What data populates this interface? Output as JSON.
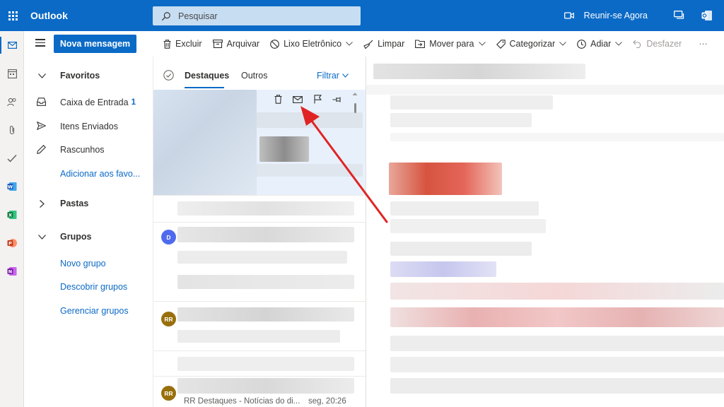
{
  "app": {
    "title": "Outlook"
  },
  "search": {
    "placeholder": "Pesquisar"
  },
  "header": {
    "meet_now": "Reunir-se Agora"
  },
  "new_message": {
    "label": "Nova mensagem"
  },
  "toolbar": {
    "delete": "Excluir",
    "archive": "Arquivar",
    "junk": "Lixo Eletrônico",
    "sweep": "Limpar",
    "move_to": "Mover para",
    "categorize": "Categorizar",
    "snooze": "Adiar",
    "undo": "Desfazer",
    "more": "···"
  },
  "folders": {
    "favorites": "Favoritos",
    "inbox": "Caixa de Entrada",
    "inbox_count": "1",
    "sent": "Itens Enviados",
    "drafts": "Rascunhos",
    "add_favorite": "Adicionar aos favo...",
    "folders_header": "Pastas",
    "groups_header": "Grupos",
    "new_group": "Novo grupo",
    "discover_groups": "Descobrir grupos",
    "manage_groups": "Gerenciar grupos"
  },
  "message_list": {
    "tab_focused": "Destaques",
    "tab_other": "Outros",
    "filter": "Filtrar",
    "avatars": [
      {
        "initials": "D",
        "color": "#4f6bed"
      },
      {
        "initials": "RR",
        "color": "#986f0b"
      },
      {
        "initials": "RR",
        "color": "#986f0b"
      }
    ],
    "last_snippet": "RR Destaques - Notícias do di...",
    "last_time": "seg, 20:26"
  },
  "colors": {
    "accent": "#0b6ac6",
    "arrow": "#e02424"
  },
  "icons": {
    "word": "word-icon",
    "excel": "excel-icon",
    "powerpoint": "powerpoint-icon",
    "onenote": "onenote-icon"
  }
}
